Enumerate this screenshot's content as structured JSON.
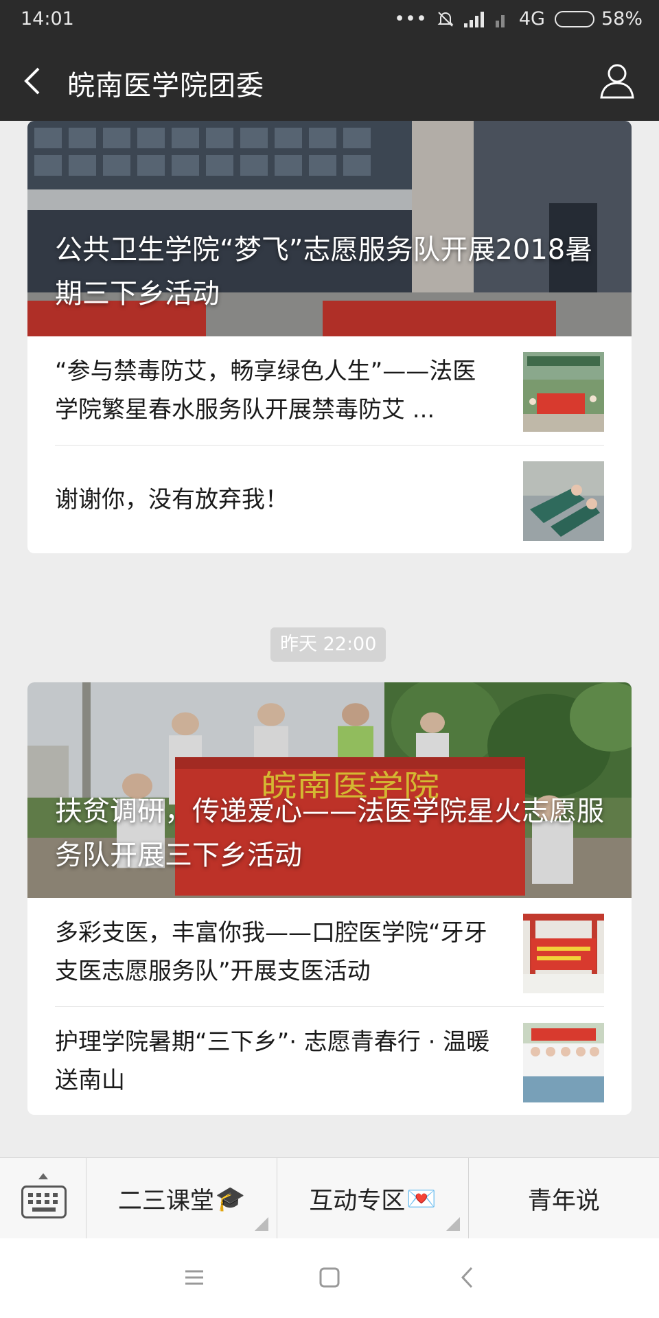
{
  "status_bar": {
    "time": "14:01",
    "network": "4G",
    "battery": "58%",
    "battery_level": 0.58
  },
  "header": {
    "title": "皖南医学院团委",
    "back_icon": "chevron-left-icon",
    "profile_icon": "person-icon"
  },
  "feed": {
    "group1": {
      "cover_title": "公共卫生学院“梦飞”志愿服务队开展2018暑期三下乡活动",
      "items": [
        {
          "title": "“参与禁毒防艾，畅享绿色人生”——法医学院繁星春水服务队开展禁毒防艾 ..."
        },
        {
          "title": "谢谢你，没有放弃我！"
        }
      ]
    },
    "timestamp": "昨天 22:00",
    "group2": {
      "cover_title": "扶贫调研，传递爱心——法医学院星火志愿服务队开展三下乡活动",
      "banner_text": "皖南医学院",
      "items": [
        {
          "title": "多彩支医，丰富你我——口腔医学院“牙牙支医志愿服务队”开展支医活动"
        },
        {
          "title": "护理学院暑期“三下乡”· 志愿青春行 · 温暖送南山"
        }
      ]
    }
  },
  "menu": {
    "items": [
      {
        "label": "二三课堂",
        "emoji": "🎓"
      },
      {
        "label": "互动专区",
        "emoji": "💌"
      },
      {
        "label": "青年说"
      }
    ]
  },
  "colors": {
    "header_bg": "#2b2b2b",
    "page_bg": "#ededed",
    "banner_red": "#d83a2e"
  }
}
